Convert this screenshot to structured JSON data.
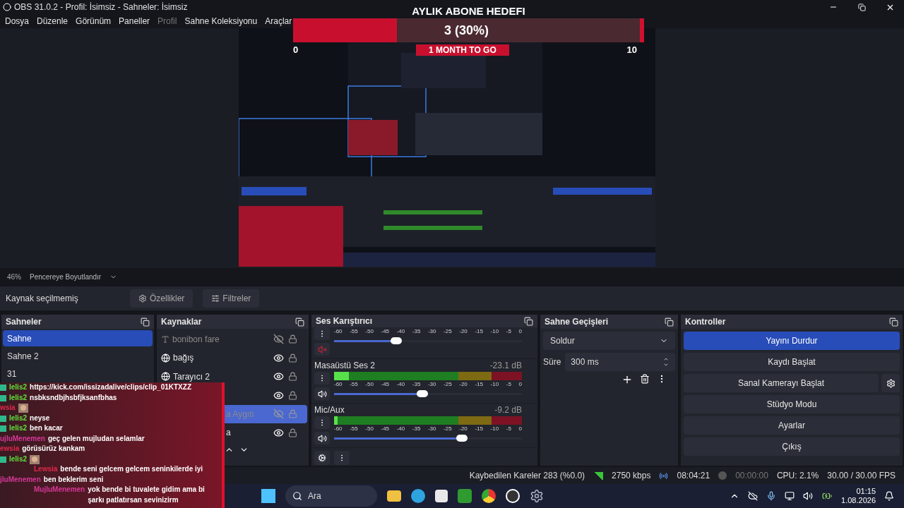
{
  "window": {
    "title": "OBS 31.0.2 - Profil: İsimsiz - Sahneler: İsimsiz"
  },
  "menu": [
    {
      "label": "Dosya",
      "disabled": false
    },
    {
      "label": "Düzenle",
      "disabled": false
    },
    {
      "label": "Görünüm",
      "disabled": false
    },
    {
      "label": "Paneller",
      "disabled": false
    },
    {
      "label": "Profil",
      "disabled": true
    },
    {
      "label": "Sahne Koleksiyonu",
      "disabled": false
    },
    {
      "label": "Araçlar",
      "disabled": false
    }
  ],
  "preview_bar": {
    "zoom": "46%",
    "mode": "Pencereye Boyutlandır"
  },
  "source_toolbar": {
    "status": "Kaynak seçilmemiş",
    "buttons": [
      "Özellikler",
      "Filtreler"
    ]
  },
  "scenes": {
    "title": "Sahneler",
    "items": [
      {
        "label": "Sahne",
        "selected": true
      },
      {
        "label": "Sahne 2",
        "selected": false
      },
      {
        "label": "31",
        "selected": false
      }
    ]
  },
  "sources": {
    "title": "Kaynaklar",
    "items": [
      {
        "name": "bonibon fare",
        "kind": "text",
        "visible": false,
        "selected": false,
        "covered": false
      },
      {
        "name": "bağış",
        "kind": "browser",
        "visible": true,
        "selected": false,
        "covered": false
      },
      {
        "name": "Tarayıcı 2",
        "kind": "browser",
        "visible": true,
        "selected": false,
        "covered": false
      },
      {
        "visible": true,
        "selected": false,
        "covered": true
      },
      {
        "name": "a Aygıtı",
        "visible": false,
        "selected": true,
        "covered": true
      },
      {
        "name": "a",
        "visible": true,
        "selected": false,
        "covered": true
      }
    ]
  },
  "mixer": {
    "title": "Ses Karıştırıcı",
    "channels": [
      {
        "muted": true,
        "level": 0.33,
        "scale": [
          "-60",
          "-55",
          "-50",
          "-45",
          "-40",
          "-35",
          "-30",
          "-25",
          "-20",
          "-15",
          "-10",
          "-5",
          "0"
        ]
      },
      {
        "name": "Masaüstü Ses 2",
        "reading": "-23.1 dB",
        "muted": false,
        "meter": {
          "level": 0.08
        },
        "level": 0.47,
        "scale": [
          "-60",
          "-55",
          "-50",
          "-45",
          "-40",
          "-35",
          "-30",
          "-25",
          "-20",
          "-15",
          "-10",
          "-5",
          "0"
        ]
      },
      {
        "name": "Mic/Aux",
        "reading": "-9.2 dB",
        "muted": false,
        "meter": {
          "level": 0.02
        },
        "level": 0.68,
        "scale": [
          "-60",
          "-55",
          "-50",
          "-45",
          "-40",
          "-35",
          "-30",
          "-25",
          "-20",
          "-15",
          "-10",
          "-5",
          "0"
        ]
      }
    ]
  },
  "transitions": {
    "title": "Sahne Geçişleri",
    "selected": "Soldur",
    "duration_label": "Süre",
    "duration": "300 ms"
  },
  "controls": {
    "title": "Kontroller",
    "buttons": [
      {
        "label": "Yayını Durdur",
        "active": true,
        "kind": "plain"
      },
      {
        "label": "Kaydı Başlat",
        "active": false,
        "kind": "plain"
      },
      {
        "label": "Sanal Kamerayı Başlat",
        "active": false,
        "kind": "with_settings"
      },
      {
        "label": "Stüdyo Modu",
        "active": false,
        "kind": "plain"
      },
      {
        "label": "Ayarlar",
        "active": false,
        "kind": "plain"
      },
      {
        "label": "Çıkış",
        "active": false,
        "kind": "plain"
      }
    ]
  },
  "status": {
    "dropped": "Kaybedilen Kareler 283 (%0.0)",
    "bitrate": "2750 kbps",
    "stream_time": "08:04:21",
    "record_time": "00:00:00",
    "cpu": "CPU: 2.1%",
    "fps": "30.00 / 30.00 FPS"
  },
  "taskbar": {
    "search": "Ara",
    "time": "01:15",
    "date": "1.08.2026"
  },
  "goal": {
    "title": "AYLIK ABONE HEDEFI",
    "count": "3 (30%)",
    "level": 0.3,
    "min": "0",
    "max": "10",
    "remaining": "1 MONTH TO GO"
  },
  "chat": [
    {
      "user": "lelis2",
      "color": "#5fe03a",
      "badge": true,
      "kind": "plain",
      "text": "https://kick.com/issizadalive/clips/clip_01KTXZZ"
    },
    {
      "user": "lelis2",
      "color": "#5fe03a",
      "badge": true,
      "kind": "plain",
      "text": "nsbksndbjhsbfjksanfbhas"
    },
    {
      "user": "wsia",
      "color": "#e0284a",
      "badge": false,
      "kind": "emote"
    },
    {
      "user": "lelis2",
      "color": "#5fe03a",
      "badge": true,
      "kind": "plain",
      "text": "neyse"
    },
    {
      "user": "lelis2",
      "color": "#5fe03a",
      "badge": true,
      "kind": "plain",
      "text": "ben kacar"
    },
    {
      "user": "ujluMenemen",
      "color": "#d8389a",
      "badge": false,
      "kind": "plain",
      "text": "geç gelen mujludan selamlar"
    },
    {
      "user": "ewsia",
      "color": "#e0284a",
      "badge": false,
      "kind": "plain",
      "text": "görüsürüz kankam"
    },
    {
      "user": "lelis2",
      "color": "#5fe03a",
      "badge": true,
      "kind": "emote"
    },
    {
      "user": "Lewsia",
      "color": "#e0284a",
      "badge": false,
      "kind": "indented",
      "text": "bende seni gelcem gelcem seninkilerde iyi"
    },
    {
      "user": "jluMenemen",
      "color": "#d8389a",
      "badge": false,
      "kind": "plain",
      "text": "ben beklerim seni"
    },
    {
      "user": "MujluMenemen",
      "color": "#d8389a",
      "badge": false,
      "kind": "indented",
      "text": "yok bende bi tuvalete gidim ama bi şarkı patlatırsan sevinizirm"
    }
  ]
}
